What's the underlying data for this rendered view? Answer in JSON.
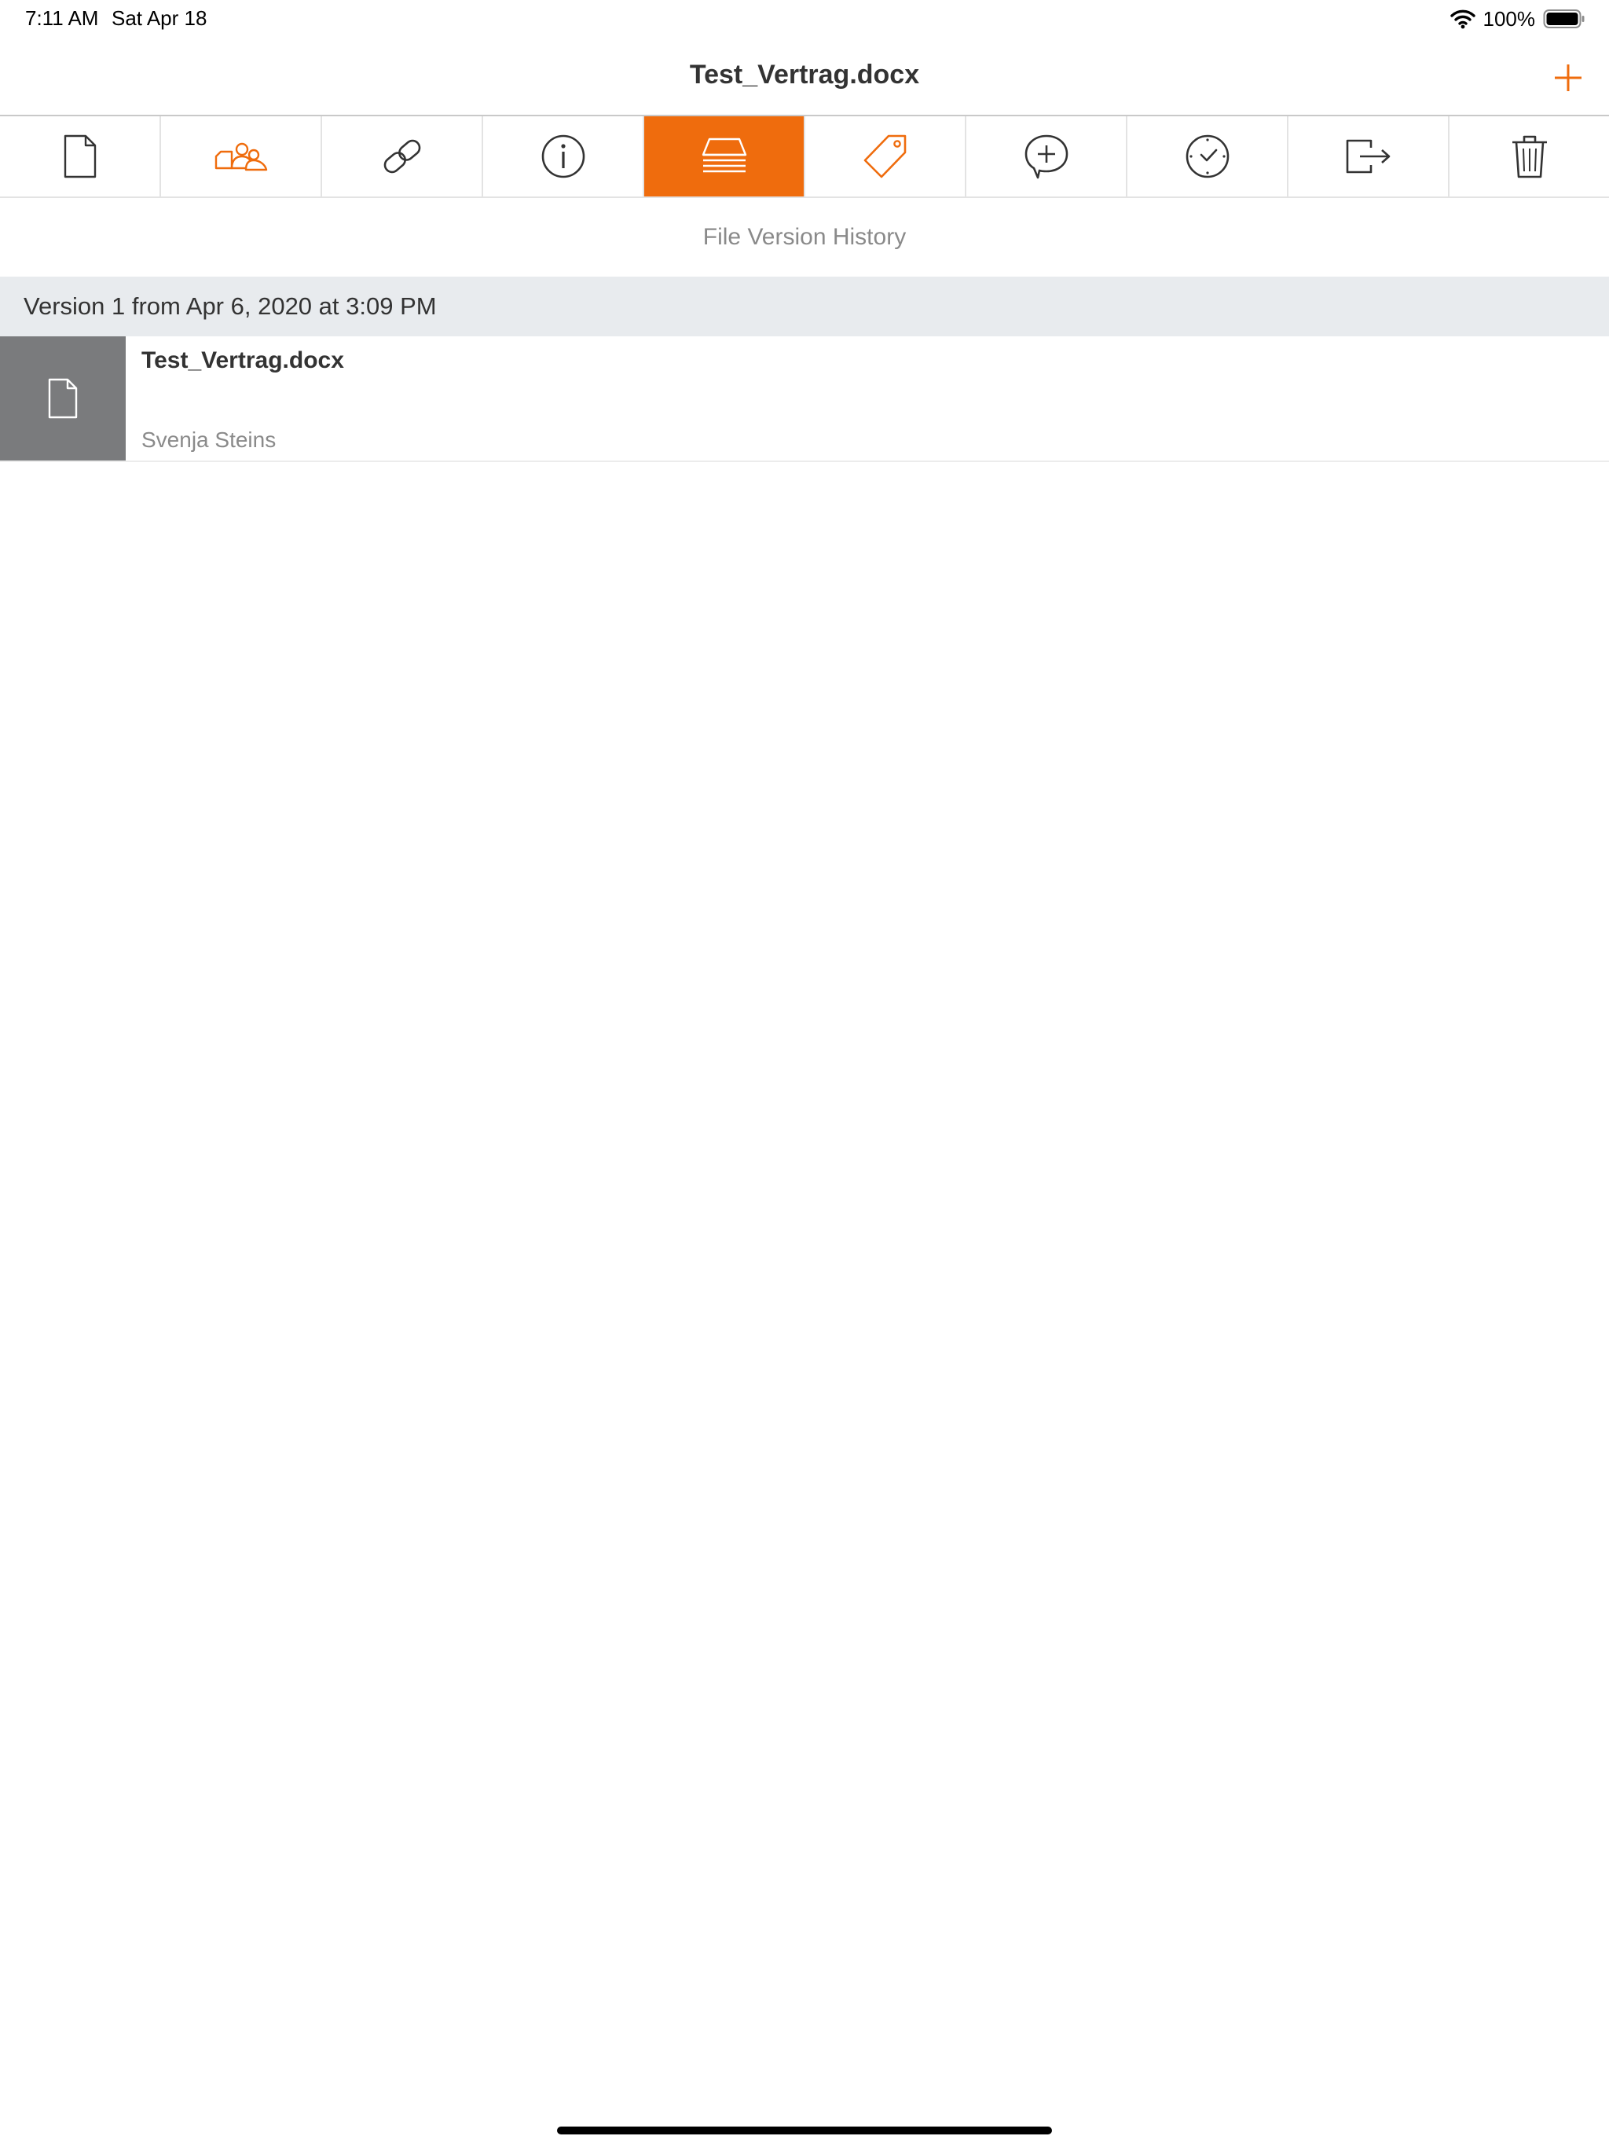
{
  "status_bar": {
    "time": "7:11 AM",
    "date": "Sat Apr 18",
    "battery": "100%",
    "icons": [
      "wifi-icon",
      "battery-icon"
    ]
  },
  "nav": {
    "title": "Test_Vertrag.docx",
    "add_icon": "plus-icon"
  },
  "colors": {
    "accent": "#ef6c0d",
    "thumb_bg": "#7a7b7d",
    "section_bg": "#e8ebee",
    "muted_text": "#8a8a8a"
  },
  "toolbar": {
    "items": [
      {
        "icon": "document-icon",
        "active": false
      },
      {
        "icon": "share-users-icon",
        "active": false
      },
      {
        "icon": "link-icon",
        "active": false
      },
      {
        "icon": "info-icon",
        "active": false
      },
      {
        "icon": "version-stack-icon",
        "active": true
      },
      {
        "icon": "tag-icon",
        "active": false
      },
      {
        "icon": "add-comment-icon",
        "active": false
      },
      {
        "icon": "clock-icon",
        "active": false
      },
      {
        "icon": "move-icon",
        "active": false
      },
      {
        "icon": "trash-icon",
        "active": false
      }
    ]
  },
  "content": {
    "section_caption": "File Version History",
    "versions": [
      {
        "header": "Version 1 from Apr 6, 2020 at 3:09 PM",
        "file_name": "Test_Vertrag.docx",
        "author": "Svenja Steins",
        "thumb_icon": "document-icon"
      }
    ]
  }
}
